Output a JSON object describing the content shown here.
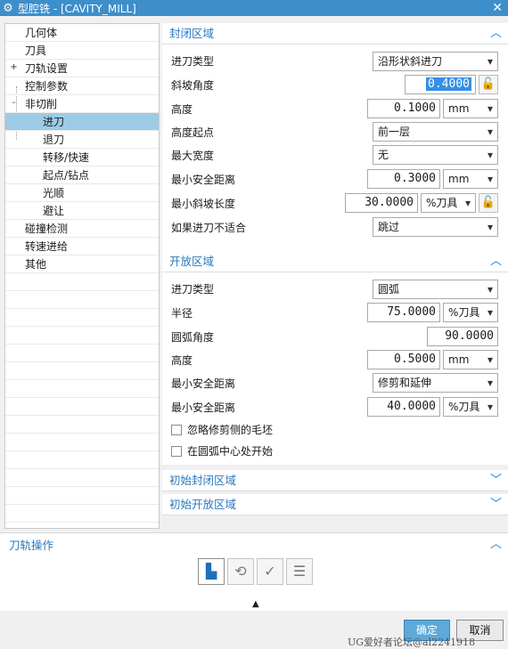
{
  "window": {
    "title": "型腔铣 - [CAVITY_MILL]",
    "gear_icon": "gear-icon",
    "close_glyph": "✕"
  },
  "tree": {
    "items": [
      {
        "label": "几何体",
        "indent": 0,
        "expander": ""
      },
      {
        "label": "刀具",
        "indent": 0,
        "expander": ""
      },
      {
        "label": "刀轨设置",
        "indent": 0,
        "expander": "+"
      },
      {
        "label": "控制参数",
        "indent": 0,
        "expander": ""
      },
      {
        "label": "非切削",
        "indent": 0,
        "expander": "-"
      },
      {
        "label": "进刀",
        "indent": 1,
        "expander": "",
        "selected": true
      },
      {
        "label": "退刀",
        "indent": 1,
        "expander": ""
      },
      {
        "label": "转移/快速",
        "indent": 1,
        "expander": ""
      },
      {
        "label": "起点/钻点",
        "indent": 1,
        "expander": ""
      },
      {
        "label": "光顺",
        "indent": 1,
        "expander": ""
      },
      {
        "label": "避让",
        "indent": 1,
        "expander": ""
      },
      {
        "label": "碰撞检测",
        "indent": 0,
        "expander": ""
      },
      {
        "label": "转速进给",
        "indent": 0,
        "expander": ""
      },
      {
        "label": "其他",
        "indent": 0,
        "expander": ""
      }
    ]
  },
  "closed_area": {
    "title": "封闭区域",
    "entry_type_label": "进刀类型",
    "entry_type_value": "沿形状斜进刀",
    "ramp_angle_label": "斜坡角度",
    "ramp_angle_value": "0.4000",
    "height_label": "高度",
    "height_value": "0.1000",
    "height_unit": "mm",
    "height_from_label": "高度起点",
    "height_from_value": "前一层",
    "max_width_label": "最大宽度",
    "max_width_value": "无",
    "min_clear_label": "最小安全距离",
    "min_clear_value": "0.3000",
    "min_clear_unit": "mm",
    "min_ramp_len_label": "最小斜坡长度",
    "min_ramp_len_value": "30.0000",
    "min_ramp_len_unit": "%刀具",
    "if_fail_label": "如果进刀不适合",
    "if_fail_value": "跳过"
  },
  "open_area": {
    "title": "开放区域",
    "entry_type_label": "进刀类型",
    "entry_type_value": "圆弧",
    "radius_label": "半径",
    "radius_value": "75.0000",
    "radius_unit": "%刀具",
    "arc_angle_label": "圆弧角度",
    "arc_angle_value": "90.0000",
    "height_label": "高度",
    "height_value": "0.5000",
    "height_unit": "mm",
    "min_clear_mode_label": "最小安全距离",
    "min_clear_mode_value": "修剪和延伸",
    "min_clear_label": "最小安全距离",
    "min_clear_value": "40.0000",
    "min_clear_unit": "%刀具",
    "ignore_trim_label": "忽略修剪侧的毛坯",
    "start_arc_center_label": "在圆弧中心处开始"
  },
  "initial_closed": {
    "title": "初始封闭区域"
  },
  "initial_open": {
    "title": "初始开放区域"
  },
  "toolpath_ops": {
    "title": "刀轨操作"
  },
  "buttons": {
    "ok": "确定",
    "cancel": "取消"
  },
  "watermark": "UG爱好者论坛@al2241918",
  "colors": {
    "title_bar": "#3d8ec9",
    "accent": "#2878c0",
    "selection": "#9ccbe6",
    "ok_button": "#5ea9d8"
  }
}
